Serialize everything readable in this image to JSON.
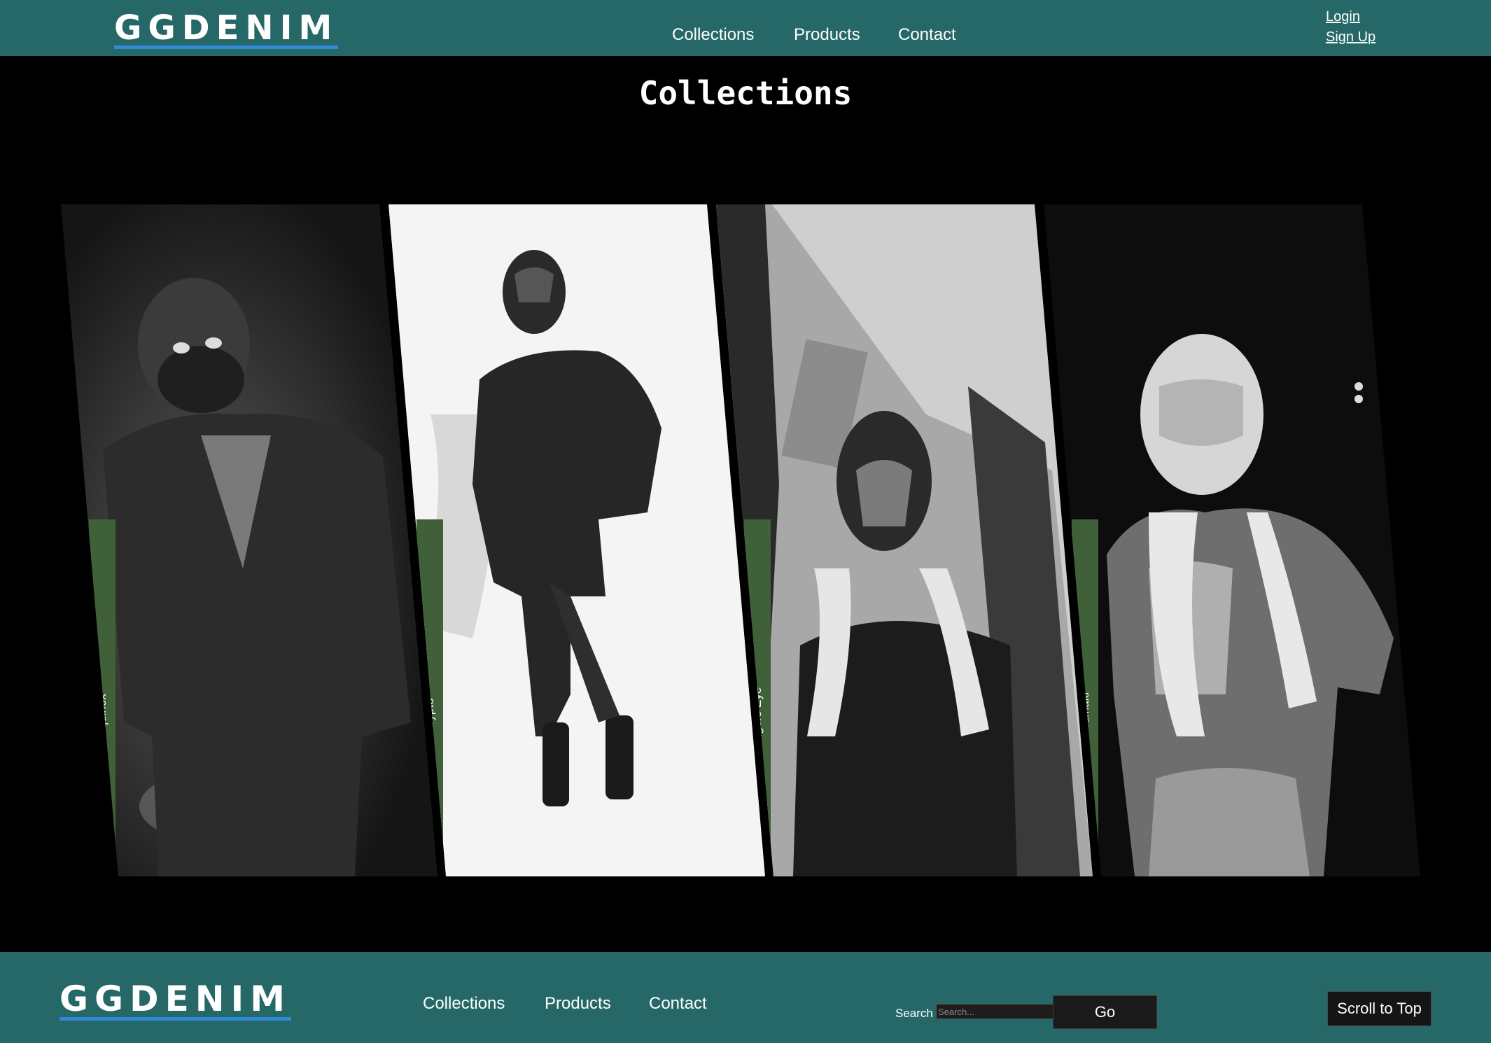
{
  "header": {
    "logo": "GGDENIM",
    "nav": [
      "Collections",
      "Products",
      "Contact"
    ],
    "login": "Login",
    "signup": "Sign Up"
  },
  "main": {
    "title": "Collections",
    "collections": [
      {
        "name": "Equinox"
      },
      {
        "name": "Krypto"
      },
      {
        "name": "Tigers Eye"
      },
      {
        "name": "Uzumaki"
      }
    ]
  },
  "footer": {
    "logo": "GGDENIM",
    "nav": [
      "Collections",
      "Products",
      "Contact"
    ],
    "search_label": "Search",
    "search_placeholder": "Search...",
    "go_label": "Go",
    "scroll_top_label": "Scroll to Top"
  },
  "colors": {
    "teal_bar": "#266868",
    "logo_underline": "#2f8ad8",
    "tag_green": "#3f6038"
  }
}
